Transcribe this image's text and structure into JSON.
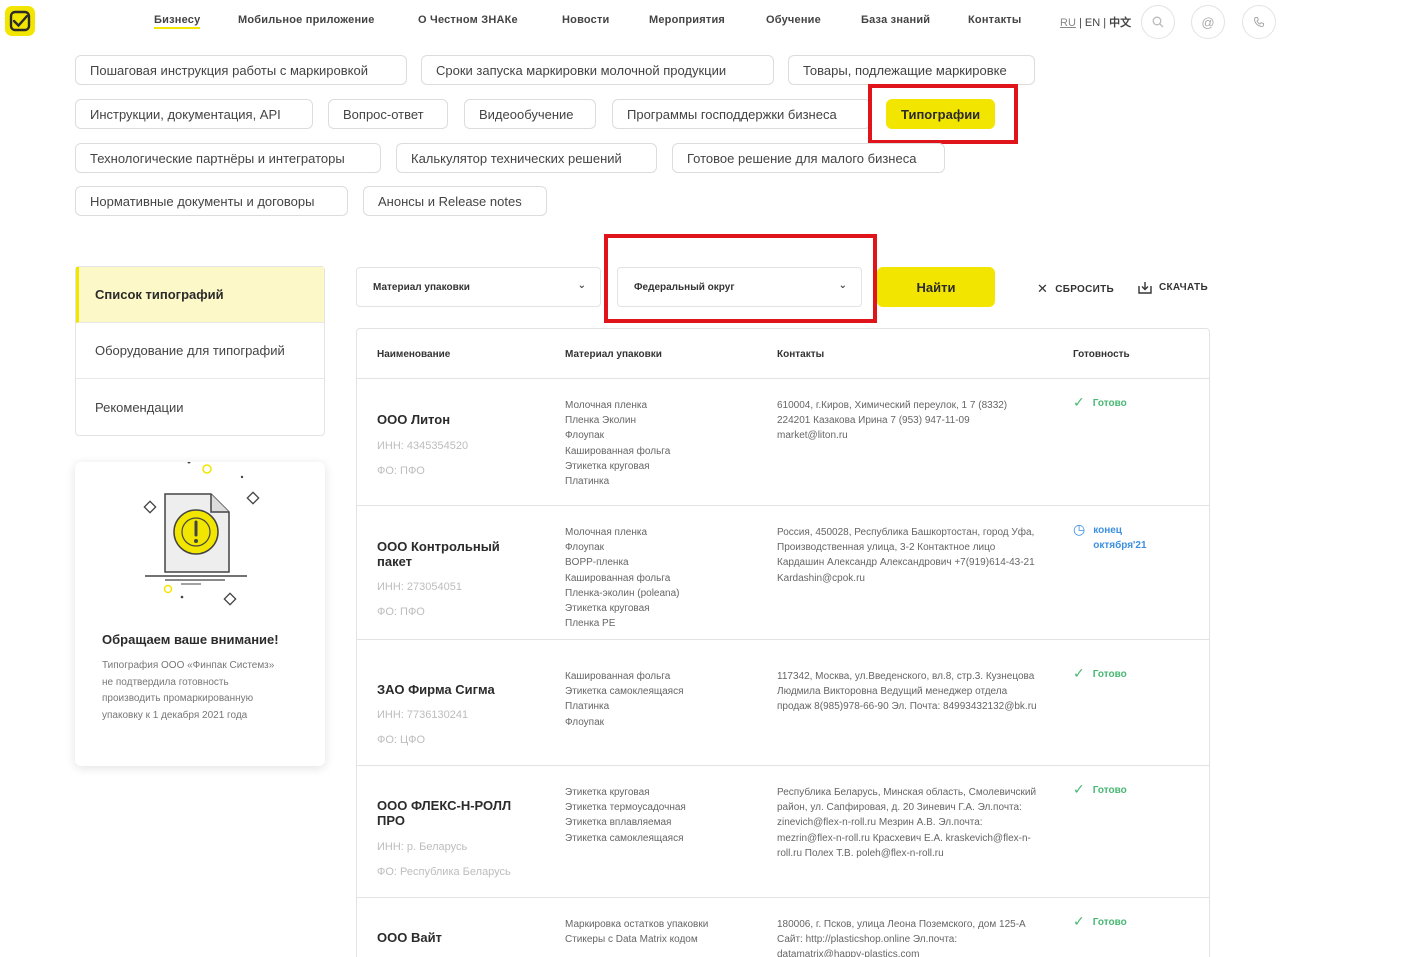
{
  "nav": {
    "items": [
      "Бизнесу",
      "Мобильное приложение",
      "О Честном ЗНАКе",
      "Новости",
      "Мероприятия",
      "Обучение",
      "База знаний",
      "Контакты"
    ],
    "active": "Бизнесу",
    "lang": {
      "ru": "RU",
      "en": "EN",
      "zh": "中文",
      "sep": "|"
    }
  },
  "chips": [
    "Пошаговая инструкция работы с маркировкой",
    "Сроки запуска маркировки молочной продукции",
    "Товары, подлежащие маркировке",
    "Инструкции, документация, API",
    "Вопрос-ответ",
    "Видеообучение",
    "Программы господдержки бизнеса",
    "Типографии",
    "Технологические партнёры и интеграторы",
    "Калькулятор технических решений",
    "Готовое решение для малого бизнеса",
    "Нормативные документы и договоры",
    "Анонсы и Release notes"
  ],
  "sidebar": {
    "items": [
      "Список типографий",
      "Оборудование для типографий",
      "Рекомендации"
    ]
  },
  "notice": {
    "title": "Обращаем ваше внимание!",
    "text": "Типография ООО «Финпак Системз» не подтвердила готовность производить промаркированную упаковку к 1 декабря 2021 года"
  },
  "filters": {
    "material": "Материал упаковки",
    "district": "Федеральный округ",
    "find": "Найти",
    "reset": "СБРОСИТЬ",
    "download": "СКАЧАТЬ"
  },
  "table": {
    "headers": [
      "Наименование",
      "Материал упаковки",
      "Контакты",
      "Готовность"
    ],
    "rows": [
      {
        "name": "ООО Литон",
        "inn": "ИНН: 4345354520",
        "fo": "ФО: ПФО",
        "materials": "Молочная пленка\nПленка Эколин\nФлоупак\nКашированная фольга\nЭтикетка круговая\nПлатинка",
        "contacts": "610004, г.Киров, Химический переулок, 1 7 (8332) 224201 Казакова Ирина 7 (953) 947-11-09 market@liton.ru",
        "status": "Готово",
        "status_type": "ready"
      },
      {
        "name": "ООО Контрольный пакет",
        "inn": "ИНН: 273054051",
        "fo": "ФО: ПФО",
        "materials": "Молочная пленка\nФлоупак\nBOPP-пленка\nКашированная фольга\nПленка-эколин (poleana)\nЭтикетка круговая\nПленка PE",
        "contacts": "Россия, 450028, Республика Башкортостан, город Уфа, Производственная улица, 3-2 Контактное лицо Кардашин Александр Александрович +7(919)614-43-21 Kardashin@cpok.ru",
        "status": "конец октября'21",
        "status_type": "pending"
      },
      {
        "name": "ЗАО Фирма Сигма",
        "inn": "ИНН: 7736130241",
        "fo": "ФО: ЦФО",
        "materials": "Кашированная фольга\nЭтикетка самоклеящаяся\nПлатинка\nФлоупак",
        "contacts": "117342, Москва, ул.Введенского, вл.8, стр.3. Кузнецова Людмила Викторовна Ведущий менеджер отдела продаж 8(985)978-66-90 Эл. Почта: 84993432132@bk.ru",
        "status": "Готово",
        "status_type": "ready"
      },
      {
        "name": "ООО ФЛЕКС-Н-РОЛЛ ПРО",
        "inn": "ИНН: р. Беларусь",
        "fo": "ФО: Республика Беларусь",
        "materials": "Этикетка круговая\nЭтикетка термоусадочная\nЭтикетка вплавляемая\nЭтикетка самоклеящаяся",
        "contacts": "Республика Беларусь, Минская область, Смолевичский район, ул. Сапфировая, д. 20 Зиневич Г.А. Эл.почта: zinevich@flex-n-roll.ru Мезрин А.В. Эл.почта: mezrin@flex-n-roll.ru Красхевич Е.А. kraskevich@flex-n-roll.ru Полех Т.В. poleh@flex-n-roll.ru",
        "status": "Готово",
        "status_type": "ready"
      },
      {
        "name": "ООО Вайт",
        "inn": "",
        "fo": "",
        "materials": "Маркировка остатков упаковки\nСтикеры с Data Matrix кодом",
        "contacts": "180006, г. Псков, улица Леона Поземского, дом 125-А Сайт: http://plasticshop.online Эл.почта: datamatrix@happy-plastics.com",
        "status": "Готово",
        "status_type": "ready"
      }
    ]
  },
  "colors": {
    "accent": "#f2e600",
    "highlight": "#e0141b",
    "ready": "#47b873",
    "pending": "#3d8fe0"
  },
  "icons": [
    "logo-icon",
    "search-icon",
    "email-icon",
    "phone-icon",
    "chevron-down-icon",
    "close-icon",
    "download-icon",
    "check-icon",
    "clock-icon",
    "document-warning-icon"
  ]
}
